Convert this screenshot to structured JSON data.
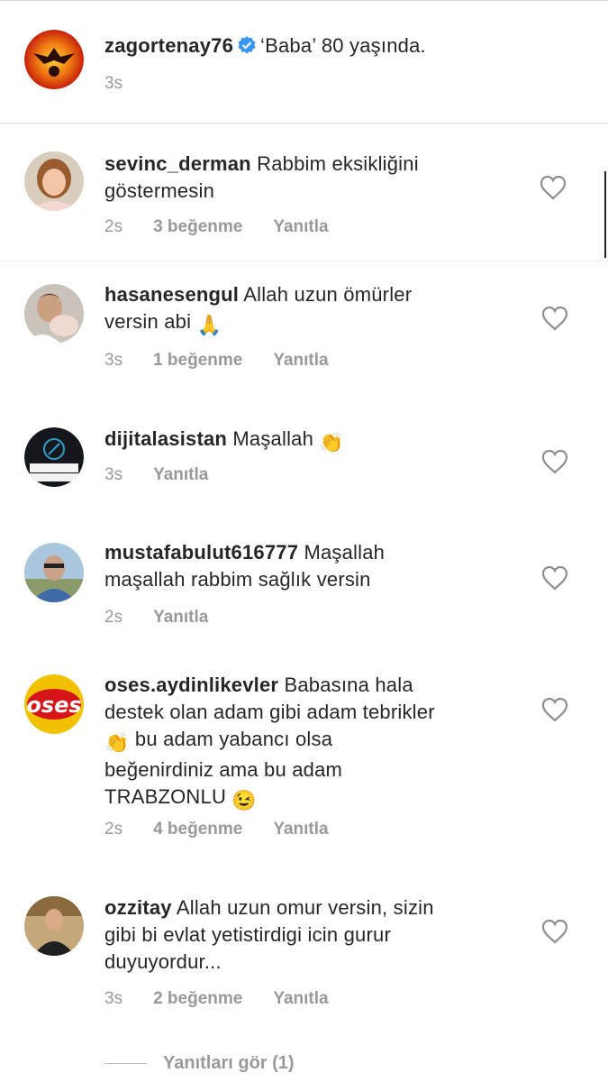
{
  "caption": {
    "username": "zagortenay76",
    "verified": true,
    "text": "‘Baba’ 80 yaşında.",
    "time": "3s"
  },
  "comments": [
    {
      "username": "sevinc_derman",
      "line1": "Rabbim eksikliğini",
      "line2": "göstermesin",
      "line3": "",
      "line4": "",
      "line5": "",
      "time": "2s",
      "likes": "3 beğenme",
      "reply": "Yanıtla"
    },
    {
      "username": "hasanesengul",
      "line1": "Allah uzun ömürler",
      "line2": "versin abi",
      "emoji2": "🙏",
      "time": "3s",
      "likes": "1 beğenme",
      "reply": "Yanıtla"
    },
    {
      "username": "dijitalasistan",
      "line1": "Maşallah",
      "emoji1": "👏",
      "time": "3s",
      "likes": "",
      "reply": "Yanıtla"
    },
    {
      "username": "mustafabulut616777",
      "line1": "Maşallah",
      "line2": "maşallah rabbim sağlık versin",
      "time": "2s",
      "likes": "",
      "reply": "Yanıtla"
    },
    {
      "username": "oses.aydinlikevler",
      "line1": "Babasına hala",
      "line2": "destek olan adam gibi adam tebrikler",
      "line3": "bu adam yabancı olsa",
      "emoji3": "👏",
      "line4": "beğenirdiniz ama bu adam",
      "line5": "TRABZONLU",
      "emoji5": "😉",
      "time": "2s",
      "likes": "4 beğenme",
      "reply": "Yanıtla"
    },
    {
      "username": "ozzitay",
      "line1": "Allah uzun omur versin, sizin",
      "line2": "gibi bi evlat yetistirdigi icin gurur",
      "line3": "duyuyordur...",
      "time": "3s",
      "likes": "2 beğenme",
      "reply": "Yanıtla"
    }
  ],
  "view_replies": "Yanıtları gör (1)",
  "avatar_texts": {
    "dijital": "DIJITAL ASISTAN",
    "oses": "oses"
  },
  "colors": {
    "meta_gray": "#999999",
    "text": "#262626",
    "verified": "#3897f0"
  }
}
